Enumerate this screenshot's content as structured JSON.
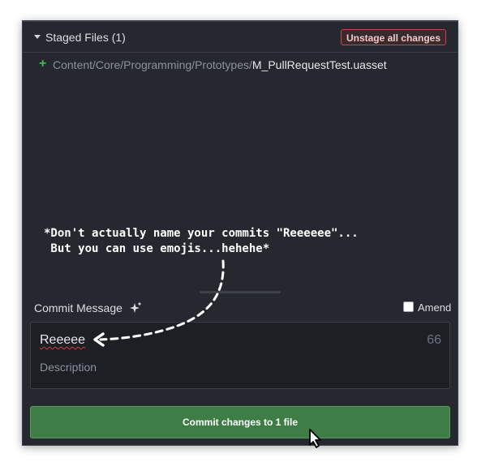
{
  "staged": {
    "title": "Staged Files (1)",
    "unstage_label": "Unstage all changes",
    "files": [
      {
        "status": "+",
        "dir_path": "Content/Core/Programming/Prototypes/",
        "file_name": "M_PullRequestTest.uasset"
      }
    ]
  },
  "annotation": {
    "line1": "*Don't actually name your commits \"Reeeeee\"...",
    "line2": " But you can use emojis...hehehe*"
  },
  "commit": {
    "label": "Commit Message",
    "amend_label": "Amend",
    "amend_checked": false,
    "summary_value": "Reeeee",
    "char_count": "66",
    "description_placeholder": "Description",
    "button_label": "Commit changes to 1 file"
  },
  "icons": {
    "collapse": "caret-down-icon",
    "added": "plus-icon",
    "generate": "sparkle-icon",
    "cursor": "mouse-cursor-icon"
  },
  "colors": {
    "panel_bg": "#25282e",
    "input_bg": "#1c1f24",
    "added_green": "#3fb950",
    "danger_red": "#c8454d",
    "commit_green": "#3e7d45"
  }
}
